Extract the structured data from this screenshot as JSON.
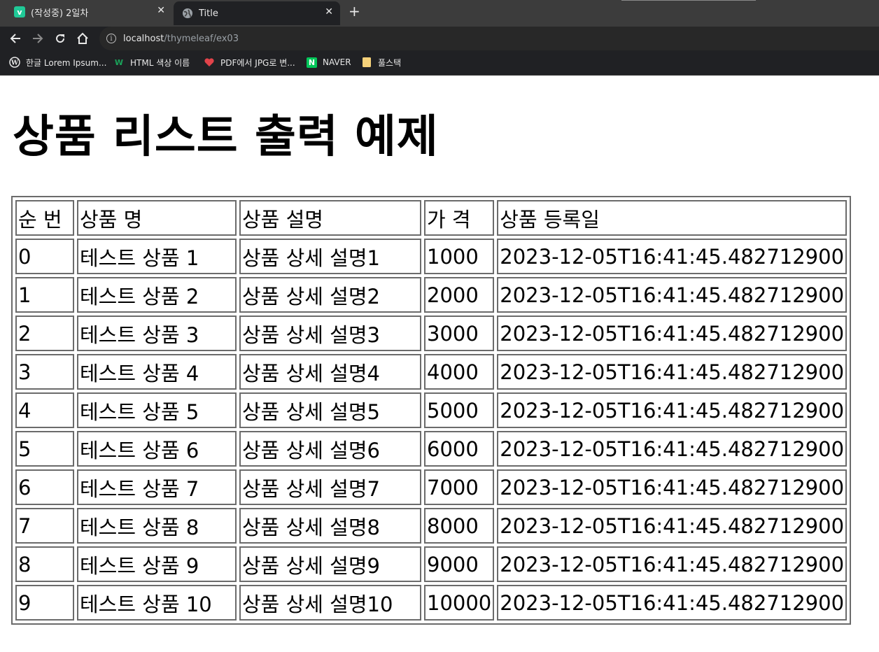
{
  "browser": {
    "tabs": [
      {
        "title": "(작성중) 2일차",
        "icon": "velog-icon",
        "icon_char": "v",
        "icon_color": "#20c997"
      },
      {
        "title": "Title",
        "icon": "globe-icon"
      }
    ],
    "new_tab_label": "+",
    "url_host": "localhost",
    "url_path": "/thymeleaf/ex03",
    "bookmarks": [
      {
        "label": "한글 Lorem Ipsum...",
        "icon": "wordpress-icon"
      },
      {
        "label": "HTML 색상 이름",
        "icon": "w-logo-icon"
      },
      {
        "label": "PDF에서 JPG로 변...",
        "icon": "heart-icon"
      },
      {
        "label": "NAVER",
        "icon": "naver-icon"
      },
      {
        "label": "풀스택",
        "icon": "folder-icon"
      }
    ]
  },
  "page": {
    "title": "상품 리스트 출력 예제",
    "table": {
      "headers": [
        "순 번",
        "상품 명",
        "상품 설명",
        "가 격",
        "상품 등록일"
      ],
      "rows": [
        [
          "0",
          "테스트 상품 1",
          "상품 상세 설명1",
          "1000",
          "2023-12-05T16:41:45.482712900"
        ],
        [
          "1",
          "테스트 상품 2",
          "상품 상세 설명2",
          "2000",
          "2023-12-05T16:41:45.482712900"
        ],
        [
          "2",
          "테스트 상품 3",
          "상품 상세 설명3",
          "3000",
          "2023-12-05T16:41:45.482712900"
        ],
        [
          "3",
          "테스트 상품 4",
          "상품 상세 설명4",
          "4000",
          "2023-12-05T16:41:45.482712900"
        ],
        [
          "4",
          "테스트 상품 5",
          "상품 상세 설명5",
          "5000",
          "2023-12-05T16:41:45.482712900"
        ],
        [
          "5",
          "테스트 상품 6",
          "상품 상세 설명6",
          "6000",
          "2023-12-05T16:41:45.482712900"
        ],
        [
          "6",
          "테스트 상품 7",
          "상품 상세 설명7",
          "7000",
          "2023-12-05T16:41:45.482712900"
        ],
        [
          "7",
          "테스트 상품 8",
          "상품 상세 설명8",
          "8000",
          "2023-12-05T16:41:45.482712900"
        ],
        [
          "8",
          "테스트 상품 9",
          "상품 상세 설명9",
          "9000",
          "2023-12-05T16:41:45.482712900"
        ],
        [
          "9",
          "테스트 상품 10",
          "상품 상세 설명10",
          "10000",
          "2023-12-05T16:41:45.482712900"
        ]
      ]
    }
  }
}
